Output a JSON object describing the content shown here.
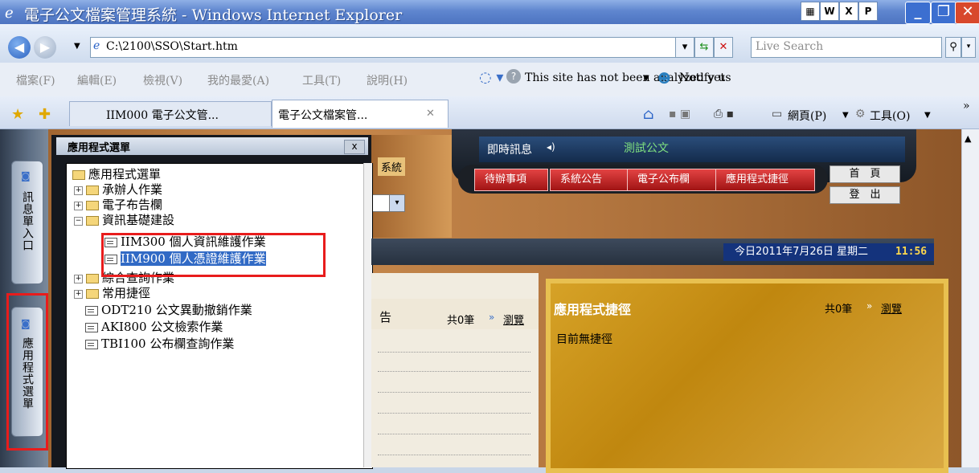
{
  "window": {
    "title": "電子公文檔案管理系統 - Windows Internet Explorer"
  },
  "address": {
    "url": "C:\\2100\\SSO\\Start.htm",
    "search_placeholder": "Live Search"
  },
  "menu": [
    "檔案(F)",
    "編輯(E)",
    "檢視(V)",
    "我的最愛(A)",
    "工具(T)",
    "說明(H)"
  ],
  "toolbar": {
    "site_status": "This site has not been analyzed yet",
    "notify": "Notify us"
  },
  "tabs": [
    {
      "label": "IIM000 電子公文管..."
    },
    {
      "label": "電子公文檔案管..."
    }
  ],
  "commands": {
    "page": "網頁(P)",
    "tools": "工具(O)"
  },
  "dock": {
    "tab1": "訊息單入口",
    "tab2": "應用程式選單"
  },
  "popup": {
    "title": "應用程式選單",
    "close": "x",
    "tree": {
      "root": "應用程式選單",
      "items": [
        {
          "label": "承辦人作業"
        },
        {
          "label": "電子布告欄"
        },
        {
          "label": "資訊基礎建設"
        },
        {
          "label": "IIM300 個人資訊維護作業"
        },
        {
          "label": "IIM900 個人憑證維護作業"
        },
        {
          "label": "綜合查詢作業"
        },
        {
          "label": "常用捷徑"
        },
        {
          "label": "ODT210 公文異動撤銷作業"
        },
        {
          "label": "AKI800 公文檢索作業"
        },
        {
          "label": "TBI100 公布欄查詢作業"
        }
      ]
    }
  },
  "hud": {
    "news_label": "即時訊息",
    "news_text": "測試公文",
    "buttons": [
      "待辦事項",
      "系統公告",
      "電子公布欄",
      "應用程式捷徑"
    ],
    "home": "首　頁",
    "logout": "登　出",
    "system_label": "系統",
    "date": "今日2011年7月26日 星期二",
    "time": "11:56"
  },
  "cork": {
    "title": "告",
    "count": "共0筆",
    "browse": "瀏覽"
  },
  "shortcut": {
    "title": "應用程式捷徑",
    "count": "共0筆",
    "browse": "瀏覽",
    "empty": "目前無捷徑"
  }
}
